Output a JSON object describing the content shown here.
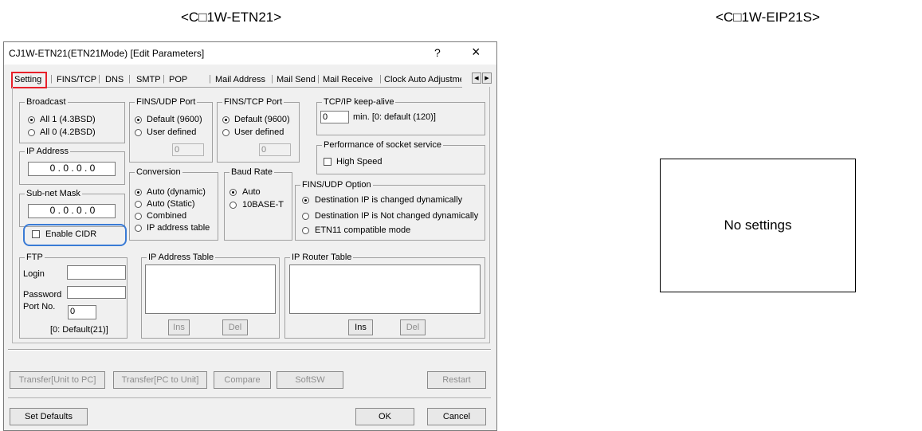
{
  "captions": {
    "left": "<C□1W-ETN21>",
    "right": "<C□1W-EIP21S>"
  },
  "dialog": {
    "title": "CJ1W-ETN21(ETN21Mode) [Edit Parameters]",
    "help": "?",
    "close": "×",
    "tabs": [
      "Setting",
      "FINS/TCP",
      "DNS",
      "SMTP",
      "POP",
      "Mail Address",
      "Mail Send",
      "Mail Receive",
      "Clock Auto Adjustme"
    ],
    "tab_scroll_left": "◀",
    "tab_scroll_right": "▶",
    "broadcast": {
      "label": "Broadcast",
      "opt1": "All 1 (4.3BSD)",
      "opt2": "All 0 (4.2BSD)",
      "selected": "All 1 (4.3BSD)"
    },
    "ip_address": {
      "label": "IP Address",
      "value": "0 . 0 . 0 . 0"
    },
    "subnet": {
      "label": "Sub-net Mask",
      "value": "0 . 0 . 0 . 0"
    },
    "cidr": {
      "label": "Enable CIDR",
      "checked": false
    },
    "fins_udp_port": {
      "label": "FINS/UDP Port",
      "opt1": "Default (9600)",
      "opt2": "User defined",
      "value": "0"
    },
    "fins_tcp_port": {
      "label": "FINS/TCP Port",
      "opt1": "Default (9600)",
      "opt2": "User defined",
      "value": "0"
    },
    "keepalive": {
      "label": "TCP/IP keep-alive",
      "value": "0",
      "hint": "min.  [0: default (120)]"
    },
    "socket": {
      "label": "Performance of socket service",
      "high_speed": "High Speed"
    },
    "conversion": {
      "label": "Conversion",
      "opts": [
        "Auto (dynamic)",
        "Auto (Static)",
        "Combined",
        "IP address table"
      ]
    },
    "baud": {
      "label": "Baud Rate",
      "opts": [
        "Auto",
        "10BASE-T"
      ]
    },
    "fins_udp_option": {
      "label": "FINS/UDP Option",
      "opts": [
        "Destination IP is changed dynamically",
        "Destination IP is Not changed dynamically",
        "ETN11 compatible mode"
      ]
    },
    "ftp": {
      "label": "FTP",
      "login": "Login",
      "password": "Password",
      "port": "Port No.",
      "port_value": "0",
      "hint": "[0: Default(21)]"
    },
    "ip_table": {
      "label": "IP Address Table",
      "ins": "Ins",
      "del": "Del"
    },
    "router_table": {
      "label": "IP Router Table",
      "ins": "Ins",
      "del": "Del"
    },
    "actions": {
      "u2p": "Transfer[Unit to PC]",
      "p2u": "Transfer[PC to Unit]",
      "compare": "Compare",
      "softsw": "SoftSW",
      "restart": "Restart"
    },
    "footer": {
      "defaults": "Set Defaults",
      "ok": "OK",
      "cancel": "Cancel"
    }
  },
  "right_panel": {
    "message": "No settings"
  },
  "colors": {
    "highlight_red": "#e8202a",
    "highlight_blue": "#3a7bd5"
  }
}
